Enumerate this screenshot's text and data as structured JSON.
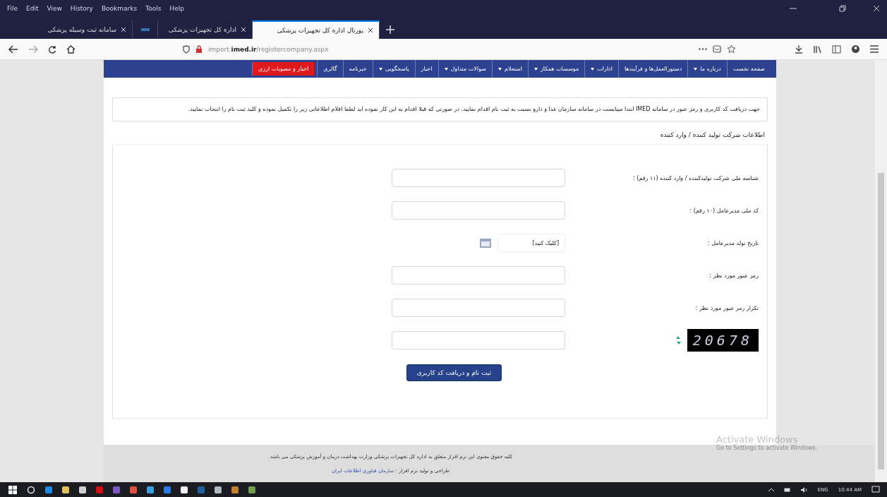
{
  "browser": {
    "menu": [
      "Help",
      "Tools",
      "Bookmarks",
      "History",
      "View",
      "Edit",
      "File"
    ],
    "tabs": [
      {
        "kind": "page",
        "title": "پورتال اداره کل تجهیزات پزشکی",
        "selected": true
      },
      {
        "kind": "page",
        "title": "اداره کل تجهیزات پزشکی",
        "selected": false
      },
      {
        "kind": "pinned",
        "selected": false
      },
      {
        "kind": "page",
        "title": "سامانه ثبت وسیله پزشکی",
        "selected": false
      }
    ],
    "url": {
      "host": "import.",
      "domain": "imed.ir",
      "path": "/registercompany.aspx"
    }
  },
  "nav": [
    {
      "label": "صفحه نخست",
      "dropdown": false,
      "highlighted": false
    },
    {
      "label": "درباره ما",
      "dropdown": true,
      "highlighted": false
    },
    {
      "label": "دستورالعمل‌ها و فرآیندها",
      "dropdown": false,
      "highlighted": false
    },
    {
      "label": "ادارات",
      "dropdown": true,
      "highlighted": false
    },
    {
      "label": "موسسات همکار",
      "dropdown": true,
      "highlighted": false
    },
    {
      "label": "استعلام",
      "dropdown": true,
      "highlighted": false
    },
    {
      "label": "سوالات متداول",
      "dropdown": true,
      "highlighted": false
    },
    {
      "label": "اخبار",
      "dropdown": false,
      "highlighted": false
    },
    {
      "label": "پاسخگویی",
      "dropdown": true,
      "highlighted": false
    },
    {
      "label": "خبرنامه",
      "dropdown": false,
      "highlighted": false
    },
    {
      "label": "گالری",
      "dropdown": false,
      "highlighted": false
    },
    {
      "label": "اخبار و مصوبات ارزی",
      "dropdown": false,
      "highlighted": true
    }
  ],
  "notice": "جهت دریافت کد کاربری و رمز عبور در سامانه IMED ابتدا میبایست در سامانه سازمان غذا و دارو نسبت به ثبت نام اقدام نمایید. در صورتی که قبلا اقدام به این کار نموده اید لطفا اقلام اطلاعاتی زیر را تکمیل نموده و کلید ثبت نام را انتخاب نمایید.",
  "section_title": "اطلاعات شرکت تولید کننده / وارد کننده",
  "form": {
    "fields": [
      {
        "kind": "text",
        "label": "شناسه ملی شرکت تولیدکننده / وارد کننده (۱۱ رقم) :"
      },
      {
        "kind": "text",
        "label": "کد ملی مدیرعامل (۱۰ رقم) :"
      },
      {
        "kind": "date",
        "label": "تاریخ تولد مدیرعامل :",
        "placeholder": "[کلیک کنید]"
      },
      {
        "kind": "password",
        "label": "رمز عبور مورد نظر :"
      },
      {
        "kind": "password",
        "label": "تکرار رمز عبور مورد نظر :"
      },
      {
        "kind": "captcha",
        "captcha": "20678"
      }
    ],
    "submit": "ثبت نام و دریافت کد کاربری"
  },
  "footer": {
    "copyright": "کلیه حقوق معنوی این نرم افزار متعلق به اداره کل تجهیزات پزشکی وزارت بهداشت درمان و آموزش پزشکی می باشد.",
    "credit": "طراحی و تولید نرم افزار :",
    "credit_link": "سازمان فناوری اطلاعات ایران"
  },
  "os_notice": {
    "title": "Activate Windows",
    "subtitle": "Go to Settings to activate Windows."
  },
  "taskbar": {
    "apps": [
      {
        "color": "#1e88e5"
      },
      {
        "color": "#e0c060"
      },
      {
        "color": "#d0d0d0"
      },
      {
        "color": "#d01010"
      },
      {
        "color": "#7a5cc0"
      },
      {
        "color": "#e05040"
      },
      {
        "color": "#3aa0e0"
      },
      {
        "color": "#2a7de0"
      },
      {
        "color": "#f0f0f0"
      },
      {
        "color": "#2060a0"
      },
      {
        "color": "#b0b8c0"
      },
      {
        "color": "#c08030"
      },
      {
        "color": "#70a050"
      }
    ],
    "language": "ENG",
    "time": "10:44 AM"
  }
}
